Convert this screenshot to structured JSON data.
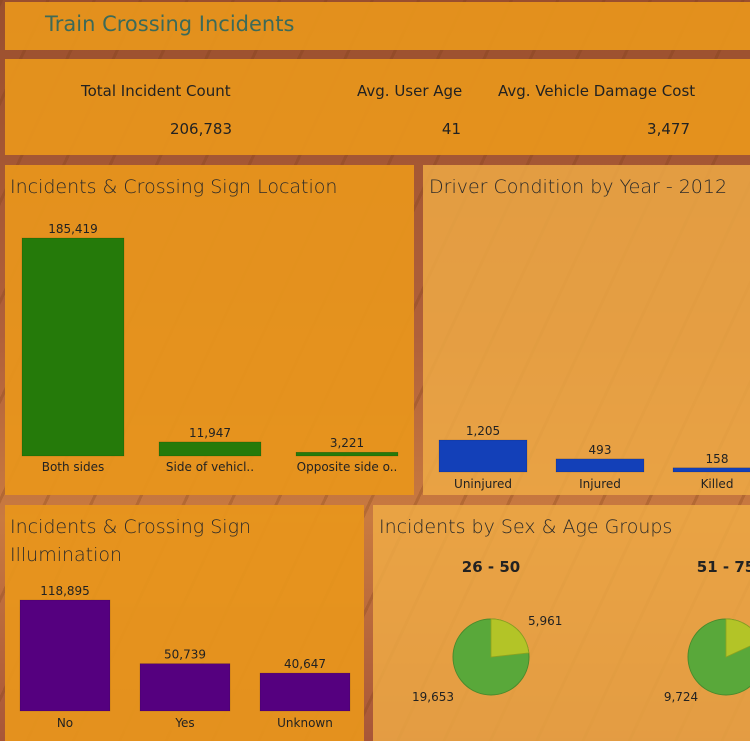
{
  "header": {
    "title": "Train Crossing Incidents"
  },
  "kpis": {
    "total_label": "Total Incident Count",
    "total_value": "206,783",
    "age_label": "Avg. User Age",
    "age_value": "41",
    "cost_label": "Avg. Vehicle Damage Cost",
    "cost_value": "3,477"
  },
  "colors": {
    "location": "#257a0a",
    "condition": "#1340b8",
    "illumination": "#55007f",
    "pie_main": "#59a83a",
    "pie_slice": "#b3c427"
  },
  "chart_data": [
    {
      "type": "bar",
      "title": "Incidents & Crossing Sign Location",
      "categories": [
        "Both sides",
        "Side of vehicl..",
        "Opposite side o.."
      ],
      "values": [
        185419,
        11947,
        3221
      ],
      "labels": [
        "185,419",
        "11,947",
        "3,221"
      ]
    },
    {
      "type": "bar",
      "title": "Driver Condition by Year - 2012",
      "categories": [
        "Uninjured",
        "Injured",
        "Killed"
      ],
      "values": [
        1205,
        493,
        158
      ],
      "labels": [
        "1,205",
        "493",
        "158"
      ]
    },
    {
      "type": "bar",
      "title": "Incidents & Crossing Sign Illumination",
      "categories": [
        "No",
        "Yes",
        "Unknown"
      ],
      "values": [
        118895,
        50739,
        40647
      ],
      "labels": [
        "118,895",
        "50,739",
        "40,647"
      ]
    },
    {
      "type": "pie",
      "title": "Incidents by Sex & Age Groups",
      "groups": [
        {
          "name": "26 - 50",
          "values": [
            19653,
            5961
          ],
          "labels": [
            "19,653",
            "5,961"
          ]
        },
        {
          "name": "51 - 75",
          "values": [
            9724,
            2160
          ],
          "labels": [
            "9,724",
            ""
          ]
        }
      ]
    }
  ]
}
